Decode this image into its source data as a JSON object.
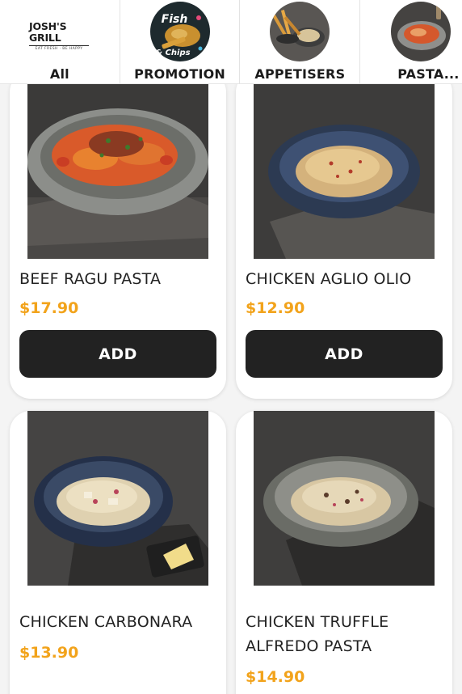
{
  "categories": [
    {
      "label": "All",
      "logo_brand": "JOSH'S GRILL",
      "logo_tagline": "EAT FRESH · BE HAPPY"
    },
    {
      "label": "PROMOTION",
      "promo_text_1": "Fish",
      "promo_text_2": "& Chips"
    },
    {
      "label": "APPETISERS"
    },
    {
      "label": "PASTA..."
    }
  ],
  "products": [
    {
      "name": "BEEF RAGU PASTA",
      "price": "$17.90",
      "add_label": "ADD"
    },
    {
      "name": "CHICKEN AGLIO OLIO",
      "price": "$12.90",
      "add_label": "ADD"
    },
    {
      "name": "CHICKEN CARBONARA",
      "price": "$13.90"
    },
    {
      "name_line1": "CHICKEN TRUFFLE",
      "name_line2": "ALFREDO PASTA",
      "price": "$14.90"
    }
  ],
  "colors": {
    "price": "#f2a31b",
    "button": "#222222",
    "background": "#f4f4f4"
  }
}
